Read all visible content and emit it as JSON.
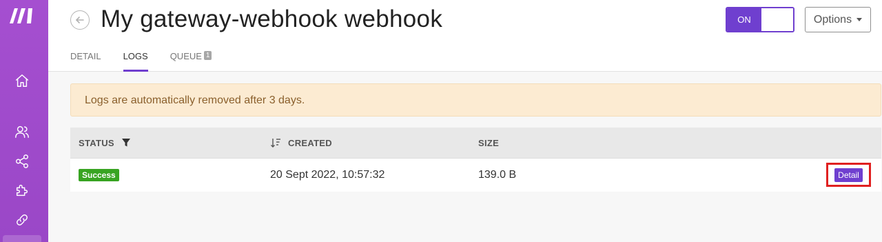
{
  "sidebar": {
    "items": [
      {
        "icon": "home-icon"
      },
      {
        "icon": "users-icon"
      },
      {
        "icon": "share-icon"
      },
      {
        "icon": "puzzle-icon"
      },
      {
        "icon": "link-icon"
      }
    ]
  },
  "header": {
    "title": "My gateway-webhook webhook",
    "toggle_label": "ON",
    "options_label": "Options"
  },
  "tabs": [
    {
      "label": "DETAIL"
    },
    {
      "label": "LOGS"
    },
    {
      "label": "QUEUE",
      "badge": "1"
    }
  ],
  "alert": {
    "text": "Logs are automatically removed after 3 days."
  },
  "table": {
    "headers": {
      "status": "STATUS",
      "created": "CREATED",
      "size": "SIZE"
    },
    "rows": [
      {
        "status": "Success",
        "created": "20 Sept 2022, 10:57:32",
        "size": "139.0 B",
        "action": "Detail"
      }
    ]
  },
  "colors": {
    "sidebar": "#a54fd0",
    "accent": "#6f3fcf",
    "success": "#38a422",
    "alert_bg": "#fcebd2",
    "highlight": "#e02020"
  }
}
